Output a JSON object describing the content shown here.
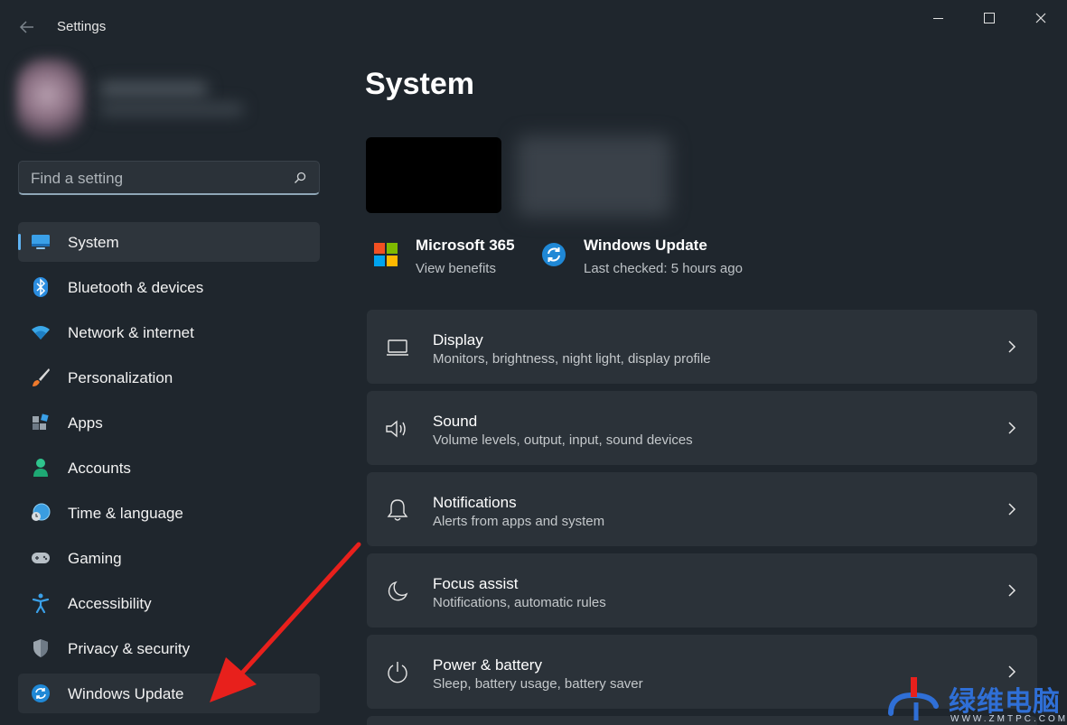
{
  "window": {
    "app_title": "Settings"
  },
  "search": {
    "placeholder": "Find a setting"
  },
  "sidebar": {
    "items": [
      {
        "label": "System",
        "icon": "monitor-icon",
        "selected": true
      },
      {
        "label": "Bluetooth & devices",
        "icon": "bluetooth-icon"
      },
      {
        "label": "Network & internet",
        "icon": "wifi-icon"
      },
      {
        "label": "Personalization",
        "icon": "paintbrush-icon"
      },
      {
        "label": "Apps",
        "icon": "apps-icon"
      },
      {
        "label": "Accounts",
        "icon": "person-icon"
      },
      {
        "label": "Time & language",
        "icon": "globe-clock-icon"
      },
      {
        "label": "Gaming",
        "icon": "gamepad-icon"
      },
      {
        "label": "Accessibility",
        "icon": "accessibility-icon"
      },
      {
        "label": "Privacy & security",
        "icon": "shield-icon"
      },
      {
        "label": "Windows Update",
        "icon": "sync-icon",
        "hovered": true
      }
    ]
  },
  "main": {
    "title": "System",
    "quick_links": [
      {
        "title": "Microsoft 365",
        "subtitle": "View benefits",
        "icon": "microsoft-logo-icon"
      },
      {
        "title": "Windows Update",
        "subtitle": "Last checked: 5 hours ago",
        "icon": "sync-icon"
      }
    ],
    "cards": [
      {
        "title": "Display",
        "subtitle": "Monitors, brightness, night light, display profile",
        "icon": "laptop-icon"
      },
      {
        "title": "Sound",
        "subtitle": "Volume levels, output, input, sound devices",
        "icon": "speaker-icon"
      },
      {
        "title": "Notifications",
        "subtitle": "Alerts from apps and system",
        "icon": "bell-icon"
      },
      {
        "title": "Focus assist",
        "subtitle": "Notifications, automatic rules",
        "icon": "moon-icon"
      },
      {
        "title": "Power & battery",
        "subtitle": "Sleep, battery usage, battery saver",
        "icon": "power-icon"
      }
    ]
  },
  "watermark": {
    "text": "绿维电脑",
    "url": "WWW.ZMTPC.COM"
  },
  "colors": {
    "background": "#1f262d",
    "card": "#2b3239",
    "accent": "#5fb2f2",
    "annotation_arrow": "#e8201c"
  }
}
